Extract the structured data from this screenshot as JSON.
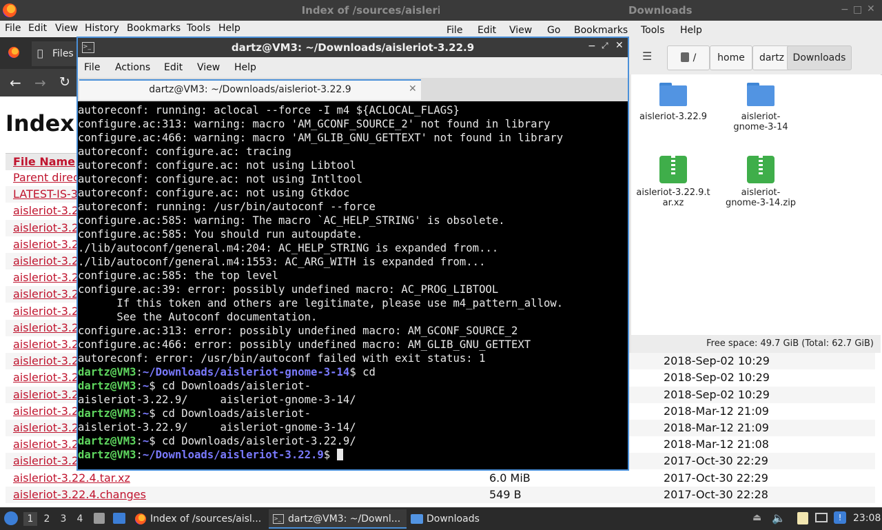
{
  "firefox": {
    "title": "Index of /sources/aisleri",
    "menu": [
      "File",
      "Edit",
      "View",
      "History",
      "Bookmarks",
      "Tools",
      "Help"
    ],
    "tab_label": "Files",
    "heading": "Index",
    "header_col": "File Name",
    "rows": [
      {
        "name": "Parent direc",
        "size": "",
        "date": ""
      },
      {
        "name": "LATEST-IS-3",
        "size": "",
        "date": ""
      },
      {
        "name": "aisleriot-3.2",
        "size": "",
        "date": ""
      },
      {
        "name": "aisleriot-3.2",
        "size": "",
        "date": ""
      },
      {
        "name": "aisleriot-3.2",
        "size": "",
        "date": ""
      },
      {
        "name": "aisleriot-3.2",
        "size": "",
        "date": ""
      },
      {
        "name": "aisleriot-3.2",
        "size": "",
        "date": ""
      },
      {
        "name": "aisleriot-3.2",
        "size": "",
        "date": ""
      },
      {
        "name": "aisleriot-3.2",
        "size": "",
        "date": ""
      },
      {
        "name": "aisleriot-3.2",
        "size": "",
        "date": ""
      },
      {
        "name": "aisleriot-3.2",
        "size": "",
        "date": ""
      },
      {
        "name": "aisleriot-3.2",
        "size": "",
        "date": "2018-Sep-02 10:29"
      },
      {
        "name": "aisleriot-3.2",
        "size": "",
        "date": "2018-Sep-02 10:29"
      },
      {
        "name": "aisleriot-3.2",
        "size": "",
        "date": "2018-Sep-02 10:29"
      },
      {
        "name": "aisleriot-3.2",
        "size": "",
        "date": "2018-Mar-12 21:09"
      },
      {
        "name": "aisleriot-3.2",
        "size": "",
        "date": "2018-Mar-12 21:09"
      },
      {
        "name": "aisleriot-3.2",
        "size": "",
        "date": "2018-Mar-12 21:08"
      },
      {
        "name": "aisleriot-3.2",
        "size": "",
        "date": "2017-Oct-30 22:29"
      },
      {
        "name": "aisleriot-3.22.4.tar.xz",
        "size": "6.0 MiB",
        "date": "2017-Oct-30 22:29"
      },
      {
        "name": "aisleriot-3.22.4.changes",
        "size": "549 B",
        "date": "2017-Oct-30 22:28"
      }
    ]
  },
  "filemanager": {
    "title": "Downloads",
    "menu": [
      "File",
      "Edit",
      "View",
      "Go",
      "Bookmarks",
      "Tools",
      "Help"
    ],
    "path": [
      "/",
      "home",
      "dartz",
      "Downloads"
    ],
    "items": [
      {
        "label": "aisleriot-3.22.9",
        "kind": "folder"
      },
      {
        "label": "aisleriot-\ngnome-3-14",
        "kind": "folder"
      },
      {
        "label": "aisleriot-3.22.9.t\nar.xz",
        "kind": "archive"
      },
      {
        "label": "aisleriot-\ngnome-3-14.zip",
        "kind": "archive"
      }
    ],
    "status": "Free space: 49.7 GiB (Total: 62.7 GiB)"
  },
  "terminal": {
    "title": "dartz@VM3: ~/Downloads/aisleriot-3.22.9",
    "menu": [
      "File",
      "Actions",
      "Edit",
      "View",
      "Help"
    ],
    "tab_label": "dartz@VM3: ~/Downloads/aisleriot-3.22.9",
    "output_lines": [
      "autoreconf: running: aclocal --force -I m4 ${ACLOCAL_FLAGS}",
      "configure.ac:313: warning: macro 'AM_GCONF_SOURCE_2' not found in library",
      "configure.ac:466: warning: macro 'AM_GLIB_GNU_GETTEXT' not found in library",
      "autoreconf: configure.ac: tracing",
      "autoreconf: configure.ac: not using Libtool",
      "autoreconf: configure.ac: not using Intltool",
      "autoreconf: configure.ac: not using Gtkdoc",
      "autoreconf: running: /usr/bin/autoconf --force",
      "configure.ac:585: warning: The macro `AC_HELP_STRING' is obsolete.",
      "configure.ac:585: You should run autoupdate.",
      "./lib/autoconf/general.m4:204: AC_HELP_STRING is expanded from...",
      "./lib/autoconf/general.m4:1553: AC_ARG_WITH is expanded from...",
      "configure.ac:585: the top level",
      "configure.ac:39: error: possibly undefined macro: AC_PROG_LIBTOOL",
      "      If this token and others are legitimate, please use m4_pattern_allow.",
      "      See the Autoconf documentation.",
      "configure.ac:313: error: possibly undefined macro: AM_GCONF_SOURCE_2",
      "configure.ac:466: error: possibly undefined macro: AM_GLIB_GNU_GETTEXT",
      "autoreconf: error: /usr/bin/autoconf failed with exit status: 1"
    ],
    "prompt_user": "dartz@VM3",
    "prompt_lines": [
      {
        "path": "~/Downloads/aisleriot-gnome-3-14",
        "cmd": " cd"
      },
      {
        "path": "~",
        "cmd": " cd Downloads/aisleriot-"
      },
      {
        "plain": "aisleriot-3.22.9/     aisleriot-gnome-3-14/"
      },
      {
        "path": "~",
        "cmd": " cd Downloads/aisleriot-"
      },
      {
        "plain": "aisleriot-3.22.9/     aisleriot-gnome-3-14/"
      },
      {
        "path": "~",
        "cmd": " cd Downloads/aisleriot-3.22.9/"
      },
      {
        "path": "~/Downloads/aisleriot-3.22.9",
        "cmd": " ",
        "cursor": true
      }
    ]
  },
  "taskbar": {
    "workspaces": [
      "1",
      "2",
      "3",
      "4"
    ],
    "tasks": [
      {
        "label": "Index of /sources/aisl...",
        "icon": "firefox-icon"
      },
      {
        "label": "dartz@VM3: ~/Downl...",
        "icon": "terminal-icon"
      },
      {
        "label": "Downloads",
        "icon": "folder-icon"
      }
    ],
    "clock": "23:08"
  }
}
